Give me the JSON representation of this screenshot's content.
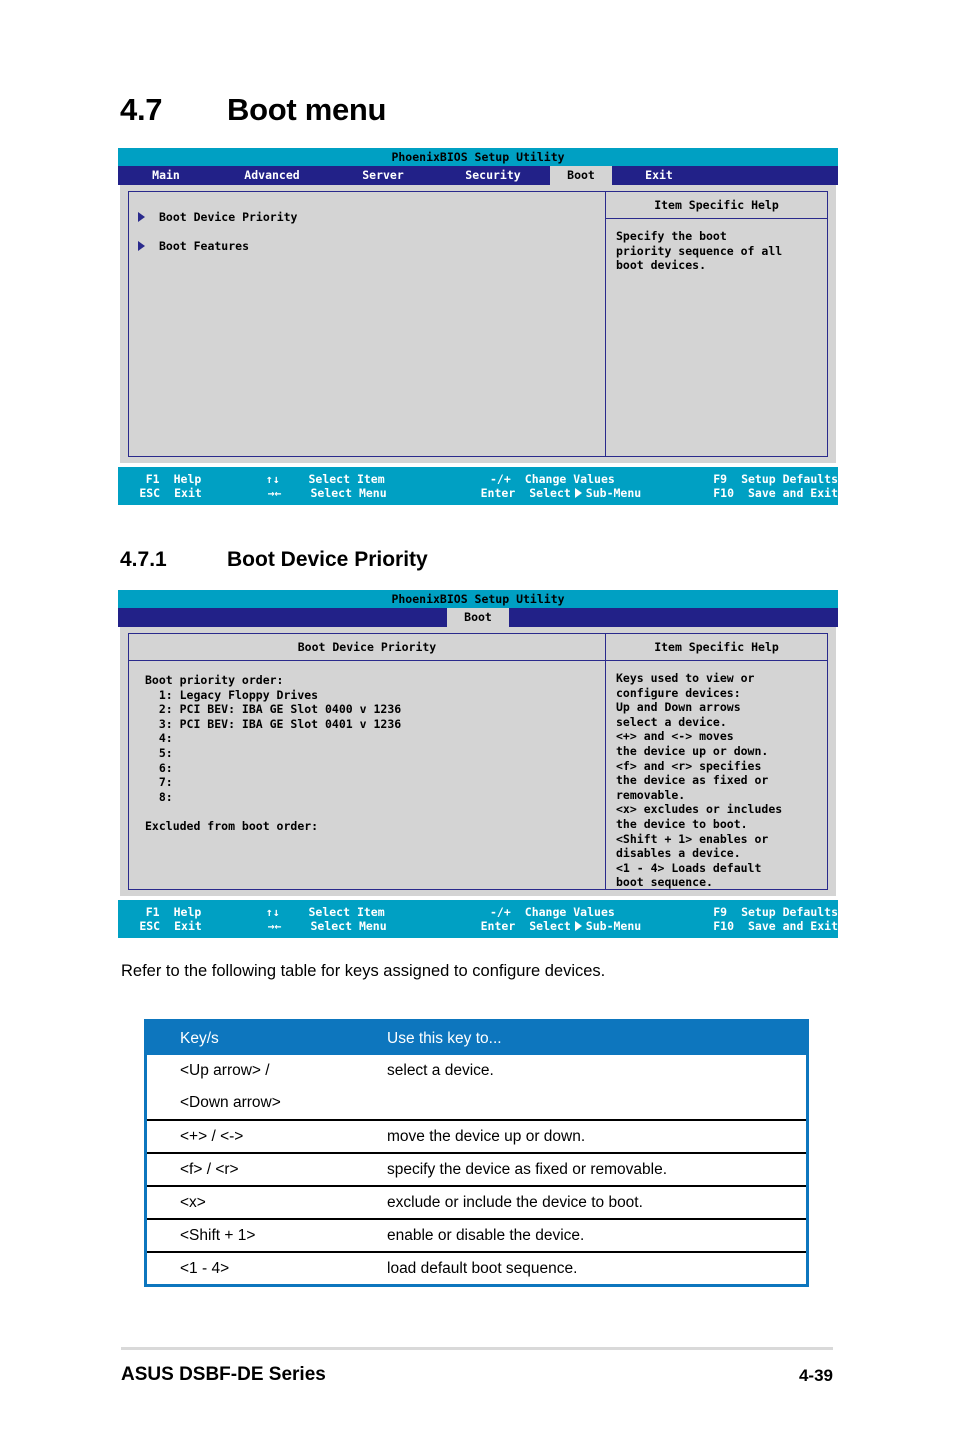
{
  "document": {
    "section_number": "4.7",
    "section_title": "Boot menu",
    "subsection_number": "4.7.1",
    "subsection_title": "Boot Device Priority",
    "paragraph": "Refer to the following table for keys assigned to configure devices.",
    "footer_left": "ASUS DSBF-DE Series",
    "footer_right": "4-39"
  },
  "colors": {
    "bios_title_bar": "#00a0c3",
    "bios_menu_bar": "#222188",
    "bios_body": "#d4d4d4",
    "bios_border": "#2a2a8c",
    "table_header": "#0d76be",
    "triangle": "#2a2a8c"
  },
  "bios_screen_1": {
    "title": "PhoenixBIOS Setup Utility",
    "menu_tabs": [
      {
        "label": "Main",
        "active": false
      },
      {
        "label": "Advanced",
        "active": false
      },
      {
        "label": "Server",
        "active": false
      },
      {
        "label": "Security",
        "active": false
      },
      {
        "label": "Boot",
        "active": true
      },
      {
        "label": "Exit",
        "active": false
      }
    ],
    "menu_items": [
      {
        "label": "Boot Device Priority"
      },
      {
        "label": "Boot Features"
      }
    ],
    "help_title": "Item Specific Help",
    "help_text": "Specify the boot\npriority sequence of all\nboot devices."
  },
  "bios_screen_2": {
    "title": "PhoenixBIOS Setup Utility",
    "menu_tabs": [
      {
        "label": "Boot",
        "active": true
      }
    ],
    "panel_title": "Boot Device Priority",
    "body_text": "Boot priority order:\n  1: Legacy Floppy Drives\n  2: PCI BEV: IBA GE Slot 0400 v 1236\n  3: PCI BEV: IBA GE Slot 0401 v 1236\n  4:\n  5:\n  6:\n  7:\n  8:\n\nExcluded from boot order:",
    "help_title": "Item Specific Help",
    "help_text": "Keys used to view or\nconfigure devices:\nUp and Down arrows\nselect a device.\n<+> and <-> moves\nthe device up or down.\n<f> and <r> specifies\nthe device as fixed or\nremovable.\n<x> excludes or includes\nthe device to boot.\n<Shift + 1> enables or\ndisables a device.\n<1 - 4> Loads default\nboot sequence."
  },
  "bios_footer": {
    "f1_key": "F1",
    "f1_label": "Help",
    "esc_key": "ESC",
    "esc_label": "Exit",
    "updown_arrows": "↑↓",
    "leftright_arrows": "→←",
    "select_item": "Select Item",
    "select_menu": "Select Menu",
    "plusminus_key": "-/+",
    "enter_key": "Enter",
    "change_values": "Change Values",
    "select_prefix": "Select",
    "submenu_label": "Sub-Menu",
    "f9_key": "F9",
    "f9_label": "Setup Defaults",
    "f10_key": "F10",
    "f10_label": "Save and Exit"
  },
  "key_table": {
    "headers": [
      "Key/s",
      "Use this key to..."
    ],
    "rows": [
      {
        "key_line1": "<Up arrow> /",
        "key_line2": "<Down arrow>",
        "action": "select a device."
      },
      {
        "key_line1": "<+> / <->",
        "key_line2": "",
        "action": "move the device up or down."
      },
      {
        "key_line1": "<f> / <r>",
        "key_line2": "",
        "action": "specify the device as fixed or removable."
      },
      {
        "key_line1": "<x>",
        "key_line2": "",
        "action": "exclude or include the device to boot."
      },
      {
        "key_line1": "<Shift + 1>",
        "key_line2": "",
        "action": "enable or disable the device."
      },
      {
        "key_line1": "<1 - 4>",
        "key_line2": "",
        "action": "load default boot sequence."
      }
    ]
  }
}
